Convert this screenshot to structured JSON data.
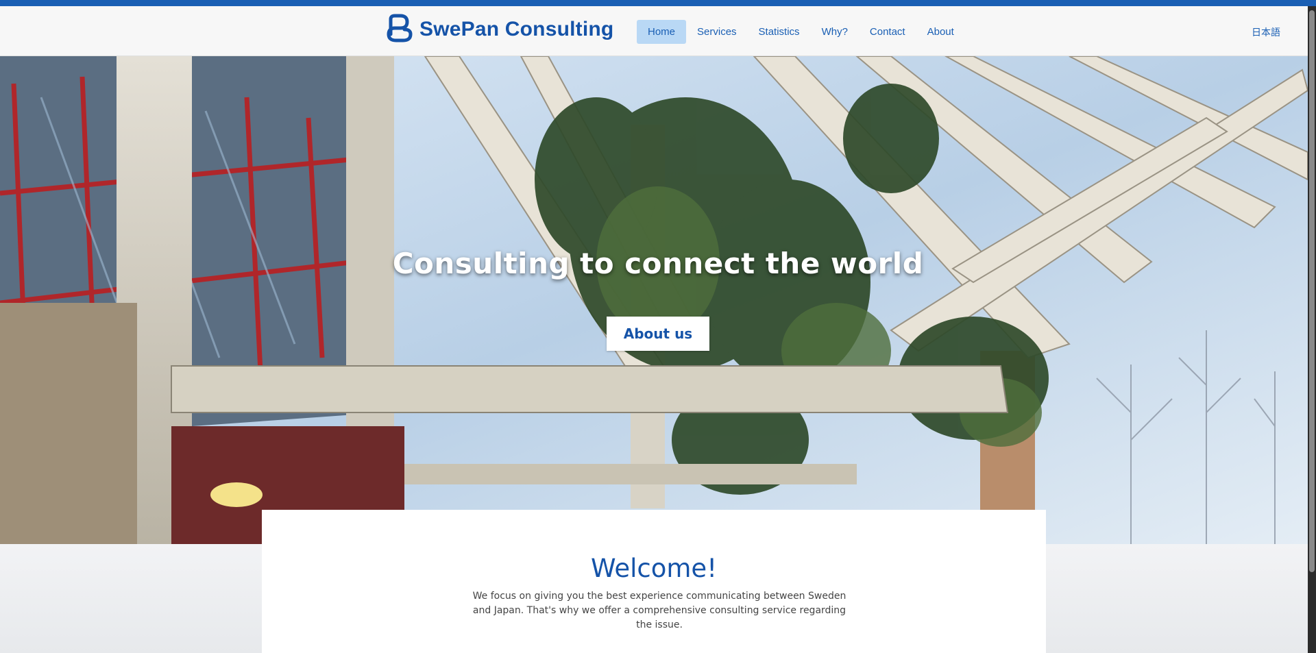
{
  "brand": {
    "name": "SwePan Consulting",
    "logo_icon": "sp-logo-icon"
  },
  "nav": {
    "items": [
      {
        "label": "Home",
        "active": true
      },
      {
        "label": "Services",
        "active": false
      },
      {
        "label": "Statistics",
        "active": false
      },
      {
        "label": "Why?",
        "active": false
      },
      {
        "label": "Contact",
        "active": false
      },
      {
        "label": "About",
        "active": false
      }
    ],
    "language_link": "日本語"
  },
  "hero": {
    "title": "Consulting to connect the world",
    "button_label": "About us"
  },
  "welcome": {
    "title": "Welcome!",
    "text": "We focus on giving you the best experience communicating between Sweden and Japan. That's why we offer a comprehensive consulting service regarding the issue."
  },
  "colors": {
    "brand_blue": "#1553a8",
    "accent_bar": "#1a5fb4",
    "nav_active_bg": "#b9d8f5"
  }
}
